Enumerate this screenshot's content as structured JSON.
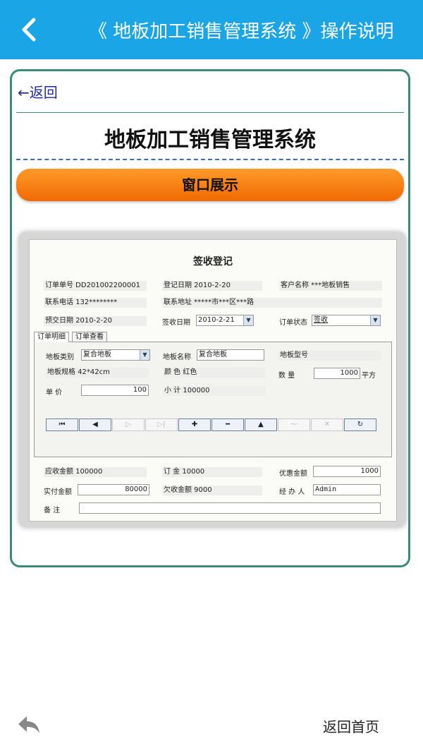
{
  "header": {
    "title": "《 地板加工销售管理系统 》操作说明"
  },
  "content": {
    "back_link": "←返回",
    "title": "地板加工销售管理系统",
    "section_button": "窗口展示"
  },
  "screenshot": {
    "title": "签收登记",
    "order_no": "订单单号 DD201002200001",
    "reg_date": "登记日期 2010-2-20",
    "customer": "客户名称 ***地板销售",
    "phone": "联系电话 132********",
    "address": "联系地址 *****市***区***路",
    "pre_date": "预交日期 2010-2-20",
    "sign_date_label": "签收日期",
    "sign_date_value": "2010-2-21",
    "order_status_label": "订单状态",
    "order_status_value": "签收",
    "tabs": [
      "订单明细",
      "订单查看"
    ],
    "floor_type_label": "地板类别",
    "floor_type_value": "复合地板",
    "floor_name_label": "地板名称",
    "floor_name_value": "复合地板",
    "floor_model": "地板型号",
    "floor_spec": "地板规格 42*42cm",
    "color": "颜    色 红色",
    "qty_label": "数    量",
    "qty_value": "1000",
    "unit": "平方",
    "price_label": "单    价",
    "price_value": "100",
    "subtotal": "小    计 100000",
    "nav": [
      "⏮",
      "◀",
      "▷",
      "▷|",
      "✚",
      "━",
      "▲",
      "⁓",
      "✕",
      "↻"
    ],
    "receivable": "应收金额 100000",
    "deposit": "订    金 10000",
    "discount_label": "优惠金额",
    "discount_value": "1000",
    "paid_label": "实付金额",
    "paid_value": "80000",
    "owed": "欠收金额 9000",
    "handler_label": "经 办 人",
    "handler_value": "Admin",
    "remark_label": "备    注"
  },
  "footer": {
    "home_link": "返回首页"
  },
  "colors": {
    "topbar": "#1aa6e6",
    "card_border": "#3c8a78",
    "button": "#f47a0c"
  }
}
